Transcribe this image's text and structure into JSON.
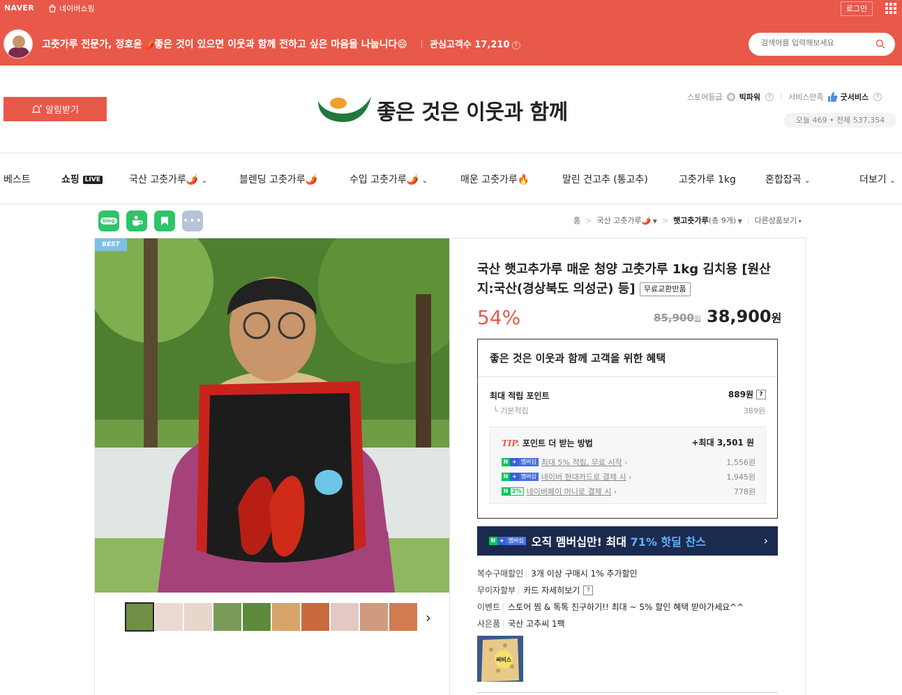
{
  "gnb": {
    "naver_logo": "NAVER",
    "naver_shopping": "네이버쇼핑",
    "login": "로그인"
  },
  "store_bar": {
    "description": "고춧가루 전문가, 정호윤🌶️좋은 것이 있으면 이웃과 함께 전하고 싶은 마음을 나눕니다😄",
    "interest_label": "관심고객수 17,210",
    "search_placeholder": "검색어를 입력해보세요"
  },
  "header": {
    "alarm_button": "알림받기",
    "store_name": "좋은 것은 이웃과 함께",
    "grade_label": "스토어등급",
    "grade_value": "빅파워",
    "service_label": "서비스만족",
    "service_value": "굿서비스",
    "visitors": "오늘 469  •  전체 537,354"
  },
  "nav": {
    "items": [
      "베스트",
      "쇼핑",
      "국산 고춧가루🌶️",
      "블렌딩 고춧가루🌶️",
      "수입 고춧가루🌶️",
      "매운 고춧가루🔥",
      "말린 건고추 (통고추)",
      "고춧가루 1kg",
      "혼합잡곡",
      "더보기"
    ],
    "live_badge": "LIVE"
  },
  "share": {
    "blog": "blog"
  },
  "breadcrumb": {
    "home": "홈",
    "category": "국산 고춧가루🌶️",
    "current": "햇고춧가루",
    "count": "(총 9개)",
    "other": "다른상품보기"
  },
  "product": {
    "best_badge": "BEST",
    "title": "국산 햇고추가루 매운 청양 고춧가루 1kg 김치용 [원산지:국산(경상북도 의성군) 등]",
    "exchange_tag": "무료교환반품",
    "discount": "54%",
    "original_price": "85,900",
    "original_unit": "원",
    "sale_price": "38,900",
    "sale_unit": "원"
  },
  "benefit": {
    "title": "좋은 것은 이웃과 함께 고객을 위한 혜택",
    "max_point_label": "최대 적립 포인트",
    "max_point_value": "889원",
    "base_label": "기본적립",
    "base_value": "389원",
    "tip_prefix": "TIP.",
    "tip_title": "포인트 더 받는 방법",
    "tip_max": "+최대 3,501 원",
    "membership_badge": "멤버십",
    "rows": [
      {
        "text": "최대 5% 적립, 무료 시작",
        "amount": "1,556원"
      },
      {
        "text": "네이버 현대카드로 결제 시",
        "amount": "1,945원"
      },
      {
        "text": "네이버페이 머니로 결제 시",
        "amount": "778원"
      }
    ],
    "percent_badge": "2%"
  },
  "member_banner": {
    "text_prefix": "오직 멤버십만! 최대 ",
    "highlight": "71% 핫딜 찬스"
  },
  "info": [
    {
      "key": "복수구매할인",
      "value": "3개 이상 구매시 1% 추가할인"
    },
    {
      "key": "무이자할부",
      "value": "카드 자세히보기"
    },
    {
      "key": "이벤트",
      "value": "스토어 찜 & 톡톡 친구하기!! 최대 ~ 5% 할인 혜택 받아가세요^^"
    },
    {
      "key": "사은품",
      "value": "국산 고추씨 1팩"
    }
  ],
  "gift_label": "써비스"
}
